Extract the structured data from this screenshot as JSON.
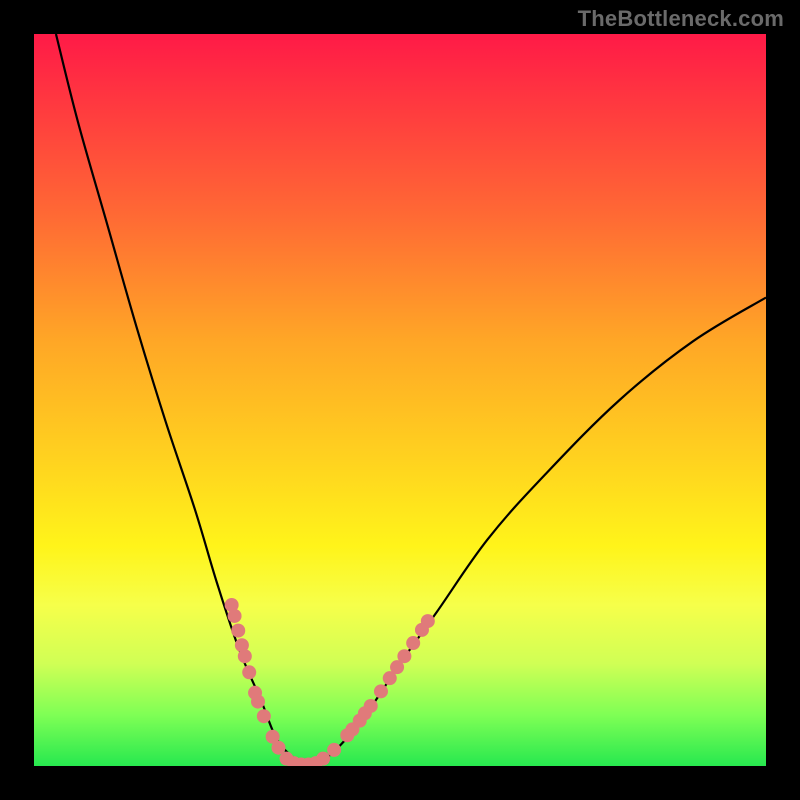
{
  "watermark": "TheBottleneck.com",
  "colors": {
    "frame": "#000000",
    "gradient_top": "#ff1a47",
    "gradient_bottom": "#27e84f",
    "curve_stroke": "#000000",
    "dot_fill": "#e07a7a"
  },
  "chart_data": {
    "type": "line",
    "title": "",
    "xlabel": "",
    "ylabel": "",
    "xlim": [
      0,
      100
    ],
    "ylim": [
      0,
      100
    ],
    "grid": false,
    "legend": false,
    "curve_points": [
      {
        "x": 3,
        "y": 100
      },
      {
        "x": 6,
        "y": 88
      },
      {
        "x": 10,
        "y": 74
      },
      {
        "x": 14,
        "y": 60
      },
      {
        "x": 18,
        "y": 47
      },
      {
        "x": 22,
        "y": 35
      },
      {
        "x": 25,
        "y": 25
      },
      {
        "x": 28,
        "y": 16
      },
      {
        "x": 31,
        "y": 9
      },
      {
        "x": 33,
        "y": 4
      },
      {
        "x": 35,
        "y": 1.5
      },
      {
        "x": 37,
        "y": 0.3
      },
      {
        "x": 39,
        "y": 0.5
      },
      {
        "x": 42,
        "y": 3
      },
      {
        "x": 46,
        "y": 8
      },
      {
        "x": 50,
        "y": 14
      },
      {
        "x": 55,
        "y": 21
      },
      {
        "x": 62,
        "y": 31
      },
      {
        "x": 70,
        "y": 40
      },
      {
        "x": 80,
        "y": 50
      },
      {
        "x": 90,
        "y": 58
      },
      {
        "x": 100,
        "y": 64
      }
    ],
    "marker_points": [
      {
        "x": 27.0,
        "y": 22.0
      },
      {
        "x": 27.4,
        "y": 20.5
      },
      {
        "x": 27.9,
        "y": 18.5
      },
      {
        "x": 28.4,
        "y": 16.5
      },
      {
        "x": 28.8,
        "y": 15.0
      },
      {
        "x": 29.4,
        "y": 12.8
      },
      {
        "x": 30.2,
        "y": 10.0
      },
      {
        "x": 30.6,
        "y": 8.8
      },
      {
        "x": 31.4,
        "y": 6.8
      },
      {
        "x": 32.6,
        "y": 4.0
      },
      {
        "x": 33.4,
        "y": 2.5
      },
      {
        "x": 34.5,
        "y": 1.0
      },
      {
        "x": 35.5,
        "y": 0.4
      },
      {
        "x": 36.5,
        "y": 0.2
      },
      {
        "x": 37.5,
        "y": 0.2
      },
      {
        "x": 38.5,
        "y": 0.4
      },
      {
        "x": 39.5,
        "y": 1.0
      },
      {
        "x": 41.0,
        "y": 2.2
      },
      {
        "x": 42.8,
        "y": 4.2
      },
      {
        "x": 43.5,
        "y": 5.0
      },
      {
        "x": 44.5,
        "y": 6.2
      },
      {
        "x": 45.2,
        "y": 7.2
      },
      {
        "x": 46.0,
        "y": 8.2
      },
      {
        "x": 47.4,
        "y": 10.2
      },
      {
        "x": 48.6,
        "y": 12.0
      },
      {
        "x": 49.6,
        "y": 13.5
      },
      {
        "x": 50.6,
        "y": 15.0
      },
      {
        "x": 51.8,
        "y": 16.8
      },
      {
        "x": 53.0,
        "y": 18.6
      },
      {
        "x": 53.8,
        "y": 19.8
      }
    ]
  }
}
